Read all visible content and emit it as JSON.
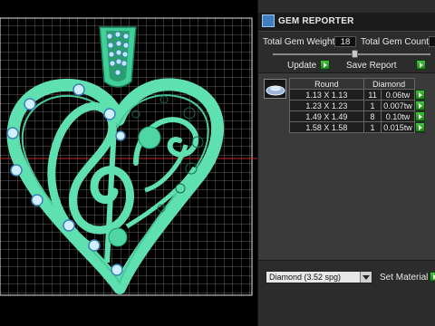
{
  "panel": {
    "title": "GEM REPORTER",
    "total_gem_weight_label": "Total Gem Weight",
    "total_gem_weight_value": "18",
    "total_gem_count_label": "Total Gem Count",
    "update_label": "Update",
    "save_report_label": "Save Report",
    "table": {
      "headers": [
        "Round",
        "Diamond"
      ],
      "rows": [
        {
          "size": "1.13 X 1.13",
          "count": "11",
          "weight": "0.06tw"
        },
        {
          "size": "1.23 X 1.23",
          "count": "1",
          "weight": "0.007tw"
        },
        {
          "size": "1.49 X 1.49",
          "count": "8",
          "weight": "0.10tw"
        },
        {
          "size": "1.58 X 1.58",
          "count": "1",
          "weight": "0.015tw"
        }
      ]
    },
    "material_select": "Diamond    (3.52 spg)",
    "set_material_label": "Set Material"
  },
  "colors": {
    "model": "#5fe0b0",
    "grid": "#cfcfcf",
    "axis_red": "#c0282b",
    "accent_green": "#34a330"
  },
  "icons": [
    "gem-reporter-icon",
    "diamond-gem-icon",
    "play-arrow-icon",
    "dropdown-arrow-icon"
  ]
}
